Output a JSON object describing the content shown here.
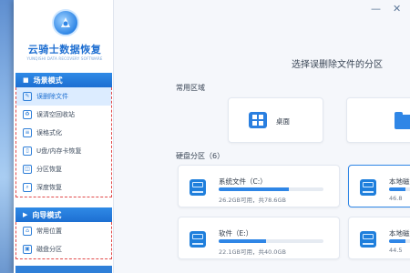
{
  "app": {
    "logo_text": "云骑士数据恢复",
    "logo_subtitle": "YUNQISHI DATA RECOVERY SOFTWARE"
  },
  "sidebar": {
    "scene_mode": {
      "label": "场景模式",
      "items": [
        {
          "label": "误删除文件",
          "icon": "delete-file-icon",
          "active": true
        },
        {
          "label": "误清空回收站",
          "icon": "recycle-bin-icon"
        },
        {
          "label": "误格式化",
          "icon": "format-icon"
        },
        {
          "label": "U盘/内存卡恢复",
          "icon": "usb-card-icon"
        },
        {
          "label": "分区恢复",
          "icon": "partition-icon"
        },
        {
          "label": "深度恢复",
          "icon": "deep-scan-icon"
        }
      ]
    },
    "wizard_mode": {
      "label": "向导模式",
      "items": [
        {
          "label": "常用位置",
          "icon": "location-icon"
        },
        {
          "label": "磁盘分区",
          "icon": "disk-partition-icon"
        }
      ]
    }
  },
  "window_controls": {
    "minimize": "—",
    "close": "✕"
  },
  "main": {
    "title": "选择误删除文件的分区",
    "common_section": "常用区域",
    "common_items": [
      {
        "label": "桌面",
        "icon": "desktop-windows-icon"
      },
      {
        "label": "",
        "icon": "folder-icon"
      }
    ],
    "disk_section": "硬盘分区（6）",
    "drives": [
      {
        "name": "系统文件（C:）",
        "info": "26.2GB可用，共78.6GB",
        "used_fraction": 0.67
      },
      {
        "name": "本地磁",
        "info": "46.8",
        "used_fraction": 0.5
      },
      {
        "name": "软件（E:）",
        "info": "22.1GB可用，共40.0GB",
        "used_fraction": 0.45
      },
      {
        "name": "本地磁",
        "info": "44.5",
        "used_fraction": 0.5
      }
    ]
  },
  "colors": {
    "accent": "#1d6fd2",
    "active_bg": "#dcecff",
    "highlight_border": "#e24b4b"
  }
}
